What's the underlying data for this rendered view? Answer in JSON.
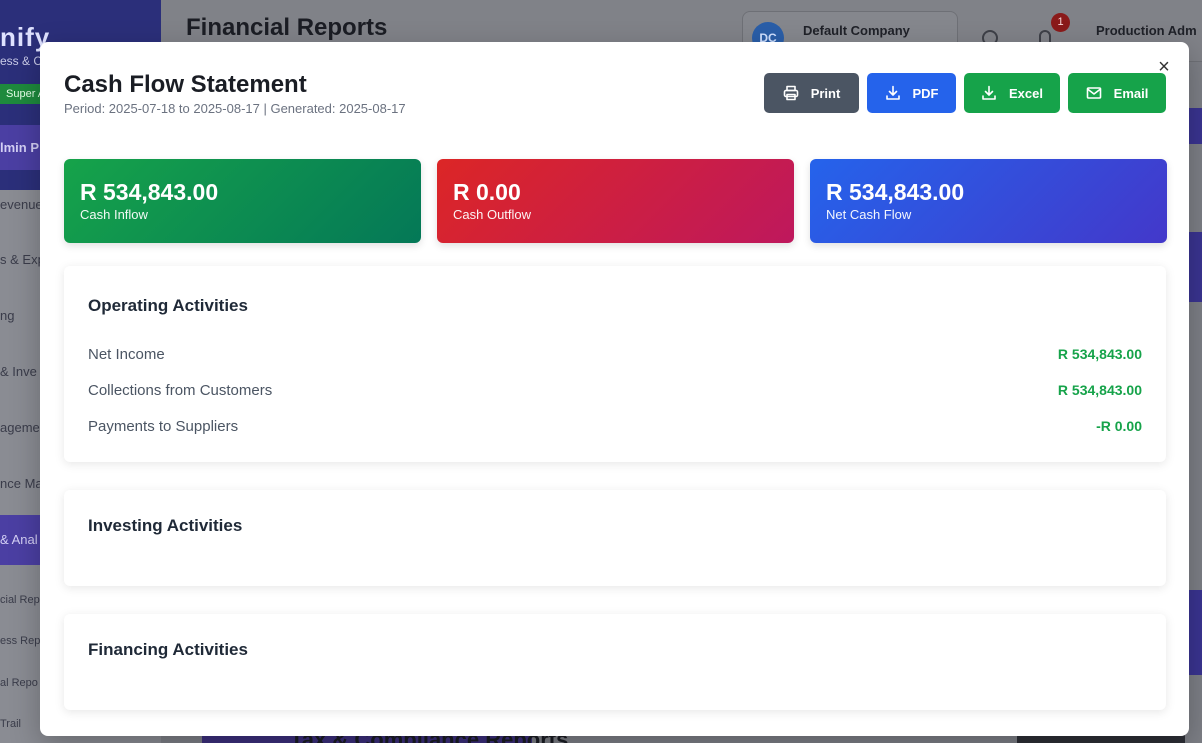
{
  "background": {
    "logo": "nify",
    "logo_sub": "ess & C",
    "role_badge": "Super A",
    "nav_top": "lmin P",
    "nav_items": [
      "evenue",
      "s & Exp",
      "ng",
      "& Inve",
      "ageme",
      "nce Ma",
      "& Anal",
      "cial Rep",
      "ess Rep",
      "al Repo",
      "Trail"
    ],
    "page_title": "Financial Reports",
    "company": {
      "initials": "DC",
      "name": "Default Company"
    },
    "notification_count": "1",
    "user": "Production Adm",
    "bottom_title": "Tax & Compliance Reports"
  },
  "modal": {
    "title": "Cash Flow Statement",
    "subtitle": "Period: 2025-07-18 to 2025-08-17 | Generated: 2025-08-17",
    "close_label": "×",
    "actions": {
      "print": "Print",
      "pdf": "PDF",
      "excel": "Excel",
      "email": "Email"
    },
    "kpis": [
      {
        "value": "R 534,843.00",
        "label": "Cash Inflow",
        "color": "#16a34a"
      },
      {
        "value": "R 0.00",
        "label": "Cash Outflow",
        "color": "#dc2626"
      },
      {
        "value": "R 534,843.00",
        "label": "Net Cash Flow",
        "color": "#2563eb"
      }
    ],
    "sections": {
      "operating": {
        "title": "Operating Activities",
        "rows": [
          {
            "label": "Net Income",
            "value": "R 534,843.00"
          },
          {
            "label": "Collections from Customers",
            "value": "R 534,843.00"
          },
          {
            "label": "Payments to Suppliers",
            "value": "-R 0.00"
          }
        ]
      },
      "investing": {
        "title": "Investing Activities"
      },
      "financing": {
        "title": "Financing Activities"
      }
    }
  }
}
